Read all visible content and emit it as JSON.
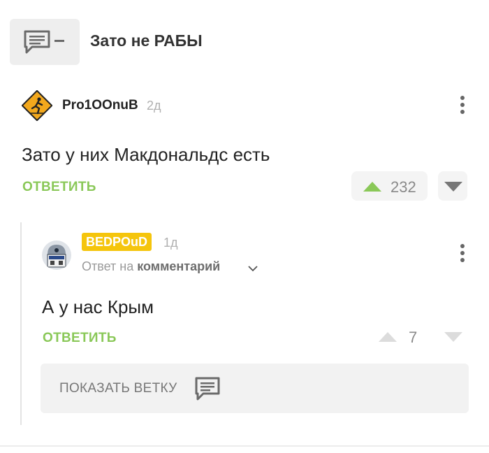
{
  "story": {
    "title": "Зато не РАБЫ",
    "icon": "comment-collapse-icon"
  },
  "comments": [
    {
      "author": "Pro1OOnuB",
      "time": "2д",
      "avatar_icon": "running-man-warning-sign",
      "text": "Зато у них Макдональдс есть",
      "reply_label": "ОТВЕТИТЬ",
      "score": "232",
      "upvoted": true
    },
    {
      "author": "BEDPOuD",
      "time": "1д",
      "avatar_icon": "robot-avatar",
      "reply_to_prefix": "Ответ на",
      "reply_to_target": "комментарий",
      "text": "А у нас Крым",
      "reply_label": "ОТВЕТИТЬ",
      "score": "7",
      "upvoted": false
    }
  ],
  "thread": {
    "show_branch_label": "ПОКАЗАТЬ ВЕТКУ"
  },
  "colors": {
    "accent_green": "#8ac858",
    "badge_yellow": "#f5c50c",
    "muted_text": "#9a9a9a",
    "panel_bg": "#f2f2f2"
  }
}
